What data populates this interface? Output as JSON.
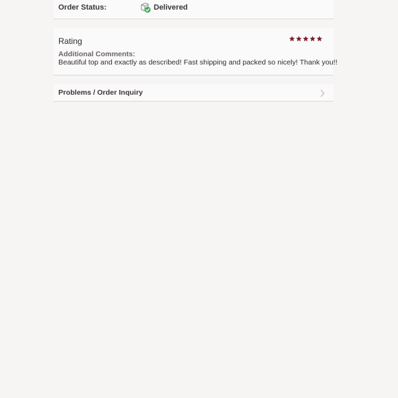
{
  "order_status": {
    "label": "Order Status:",
    "value": "Delivered",
    "icon": "delivered-box-check-icon",
    "icon_check_color": "#3cae5a"
  },
  "rating": {
    "title": "Rating",
    "stars": 5,
    "max_stars": 5,
    "star_color": "#7a1f2b",
    "comments_label": "Additional Comments:",
    "comments_text": "Beautiful top and exactly as described! Fast shipping and packed so nicely! Thank you!!"
  },
  "problems": {
    "label": "Problems / Order Inquiry",
    "icon": "chevron-right-icon"
  }
}
